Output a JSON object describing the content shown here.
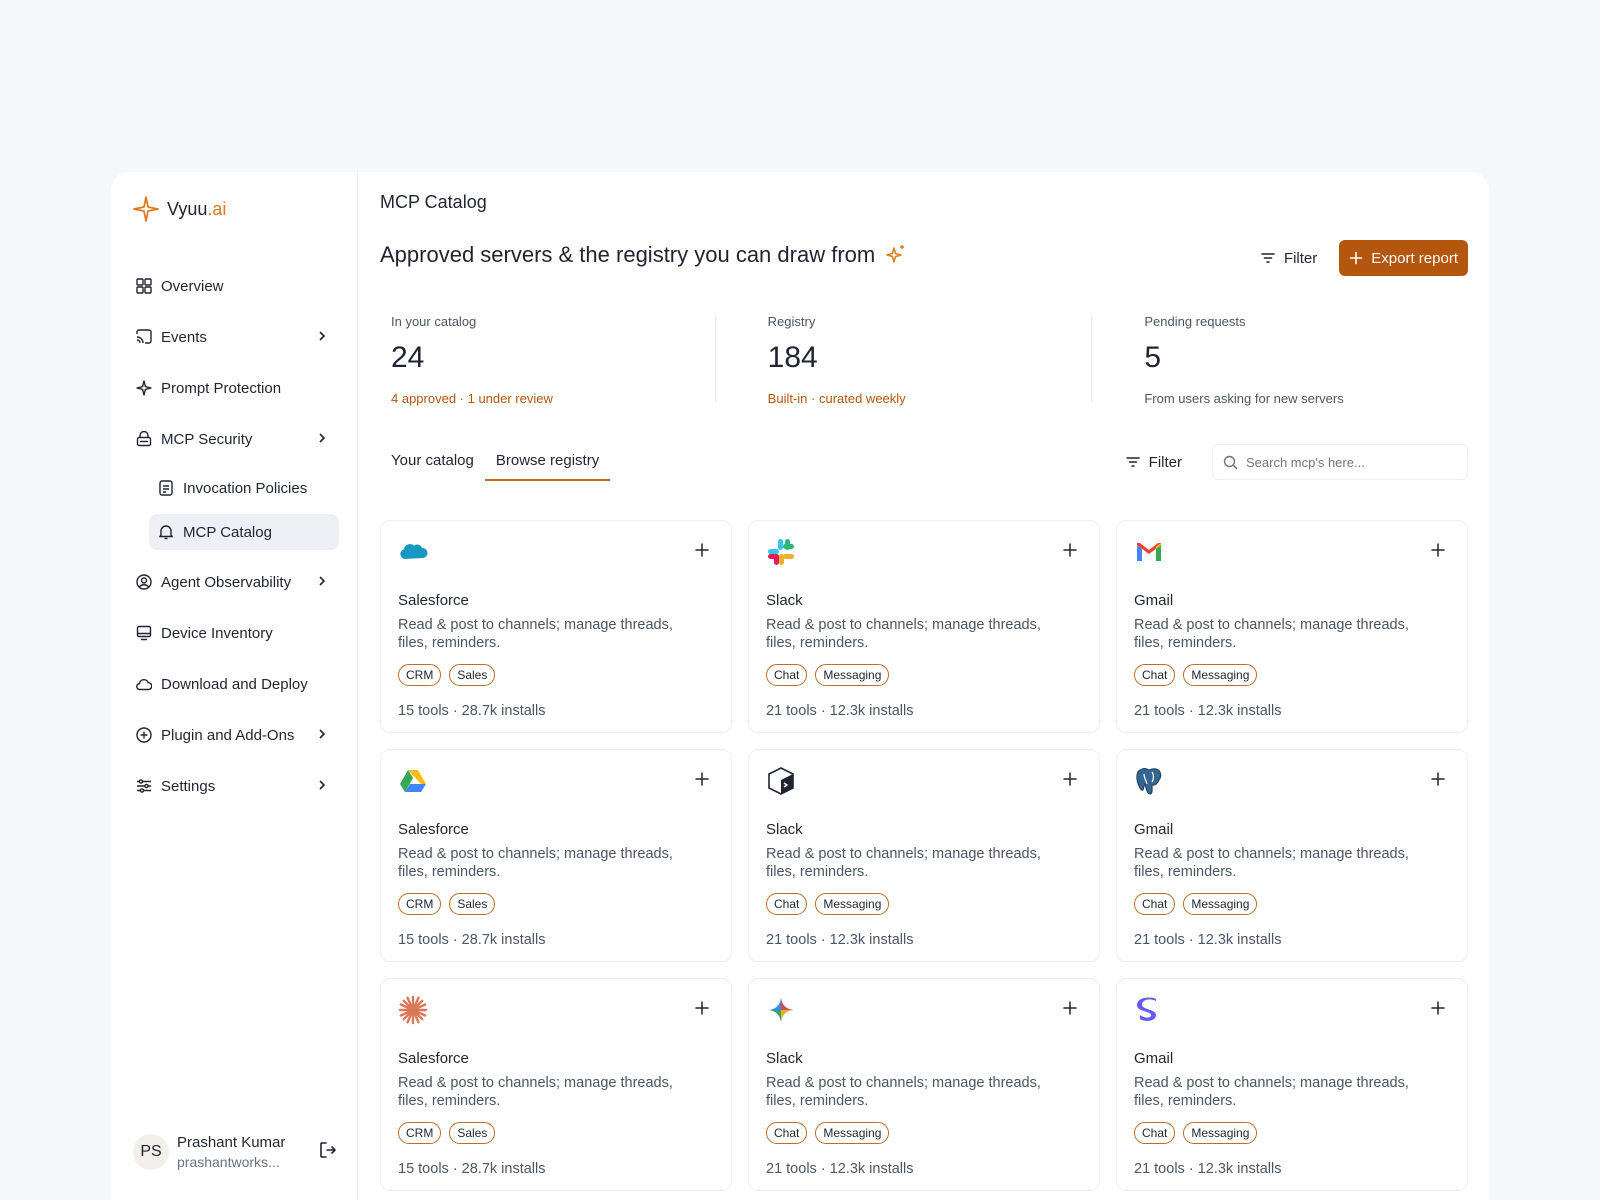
{
  "brand": {
    "name": "Vyuu",
    "suffix": ".ai",
    "accent": "#e07a1f"
  },
  "sidebar": {
    "items": [
      {
        "label": "Overview"
      },
      {
        "label": "Events"
      },
      {
        "label": "Prompt Protection"
      },
      {
        "label": "MCP Security"
      },
      {
        "label": "Invocation Policies"
      },
      {
        "label": "MCP Catalog"
      },
      {
        "label": "Agent Observability"
      },
      {
        "label": "Device Inventory"
      },
      {
        "label": "Download and Deploy"
      },
      {
        "label": "Plugin and Add-Ons"
      },
      {
        "label": "Settings"
      }
    ],
    "active": "MCP Catalog"
  },
  "user": {
    "initials": "PS",
    "name": "Prashant Kumar",
    "email": "prashantworks..."
  },
  "header": {
    "page_title": "MCP Catalog",
    "headline": "Approved servers & the registry you can draw from",
    "filter_label": "Filter",
    "export_label": "Export report",
    "primary_color": "#b5560f"
  },
  "stats": [
    {
      "label": "In your catalog",
      "value": "24",
      "sub": "4 approved · 1 under review"
    },
    {
      "label": "Registry",
      "value": "184",
      "sub": "Built-in · curated weekly"
    },
    {
      "label": "Pending requests",
      "value": "5",
      "sub": "From users asking for new servers"
    }
  ],
  "tabs": [
    {
      "label": "Your catalog"
    },
    {
      "label": "Browse registry"
    }
  ],
  "active_tab": "Browse registry",
  "tools": {
    "filter_label": "Filter",
    "search_placeholder": "Search mcp's here..."
  },
  "cards": [
    {
      "icon": "salesforce-icon",
      "name": "Salesforce",
      "desc": "Read & post to channels; manage threads, files, reminders.",
      "tags": [
        "CRM",
        "Sales"
      ],
      "meta": "15 tools · 28.7k installs"
    },
    {
      "icon": "slack-icon",
      "name": "Slack",
      "desc": "Read & post to channels; manage threads, files, reminders.",
      "tags": [
        "Chat",
        "Messaging"
      ],
      "meta": "21 tools · 12.3k installs"
    },
    {
      "icon": "gmail-icon",
      "name": "Gmail",
      "desc": "Read & post to channels; manage threads, files, reminders.",
      "tags": [
        "Chat",
        "Messaging"
      ],
      "meta": "21 tools · 12.3k installs"
    },
    {
      "icon": "google-drive-icon",
      "name": "Salesforce",
      "desc": "Read & post to channels; manage threads, files, reminders.",
      "tags": [
        "CRM",
        "Sales"
      ],
      "meta": "15 tools · 28.7k installs"
    },
    {
      "icon": "terminal-cube-icon",
      "name": "Slack",
      "desc": "Read & post to channels; manage threads, files, reminders.",
      "tags": [
        "Chat",
        "Messaging"
      ],
      "meta": "21 tools · 12.3k installs"
    },
    {
      "icon": "postgres-elephant-icon",
      "name": "Gmail",
      "desc": "Read & post to channels; manage threads, files, reminders.",
      "tags": [
        "Chat",
        "Messaging"
      ],
      "meta": "21 tools · 12.3k installs"
    },
    {
      "icon": "claude-burst-icon",
      "name": "Salesforce",
      "desc": "Read & post to channels; manage threads, files, reminders.",
      "tags": [
        "CRM",
        "Sales"
      ],
      "meta": "15 tools · 28.7k installs"
    },
    {
      "icon": "gemini-sparkle-icon",
      "name": "Slack",
      "desc": "Read & post to channels; manage threads, files, reminders.",
      "tags": [
        "Chat",
        "Messaging"
      ],
      "meta": "21 tools · 12.3k installs"
    },
    {
      "icon": "stripe-s-icon",
      "name": "Gmail",
      "desc": "Read & post to channels; manage threads, files, reminders.",
      "tags": [
        "Chat",
        "Messaging"
      ],
      "meta": "21 tools · 12.3k installs"
    }
  ]
}
